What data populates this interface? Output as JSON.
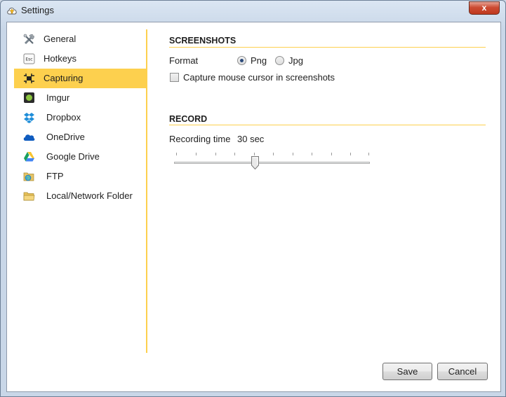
{
  "window": {
    "title": "Settings",
    "close_label": "x"
  },
  "sidebar": {
    "items": [
      {
        "label": "General",
        "icon": "tools-icon"
      },
      {
        "label": "Hotkeys",
        "icon": "esc-key-icon",
        "icon_text": "Esc"
      },
      {
        "label": "Capturing",
        "icon": "capture-icon",
        "active": true
      },
      {
        "label": "Imgur",
        "icon": "imgur-icon"
      },
      {
        "label": "Dropbox",
        "icon": "dropbox-icon"
      },
      {
        "label": "OneDrive",
        "icon": "onedrive-icon"
      },
      {
        "label": "Google Drive",
        "icon": "google-drive-icon"
      },
      {
        "label": "FTP",
        "icon": "ftp-icon"
      },
      {
        "label": "Local/Network Folder",
        "icon": "folder-icon"
      }
    ]
  },
  "screenshots": {
    "heading": "SCREENSHOTS",
    "format_label": "Format",
    "options": [
      {
        "label": "Png",
        "checked": true
      },
      {
        "label": "Jpg",
        "checked": false
      }
    ],
    "cursor_label": "Capture mouse cursor in screenshots",
    "cursor_checked": false
  },
  "record": {
    "heading": "RECORD",
    "time_label": "Recording time",
    "time_value": "30 sec",
    "slider_fraction": 0.41
  },
  "footer": {
    "save_label": "Save",
    "cancel_label": "Cancel"
  },
  "colors": {
    "accent": "#fdd04e",
    "window_frame": "#c9d7e8",
    "close": "#c0391e"
  }
}
